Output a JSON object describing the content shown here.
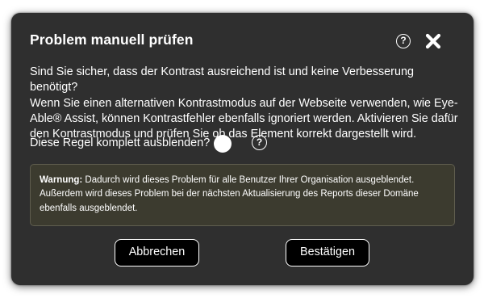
{
  "dialog": {
    "title": "Problem manuell prüfen",
    "help_icon_glyph": "?",
    "close_icon": "close-x-icon",
    "body_lines": [
      "Sind Sie sicher, dass der Kontrast ausreichend ist und keine Verbesserung benötigt?",
      "Wenn Sie einen alternativen Kontrastmodus auf der Webseite verwenden, wie Eye-",
      "Able® Assist, können Kontrastfehler ebenfalls ignoriert werden. Aktivieren Sie dafür",
      "den Kontrastmodus und prüfen Sie ob das Element korrekt dargestellt wird."
    ],
    "rule_label": "Diese Regel komplett ausblenden?",
    "rule_toggle_on": false,
    "rule_help_glyph": "?",
    "warning": {
      "label": "Warnung:",
      "line1": " Dadurch wird dieses Problem für alle Benutzer Ihrer Organisation ausgeblendet.",
      "line2": "Außerdem wird dieses Problem bei der nächsten Aktualisierung des Reports dieser Domäne",
      "line3": "ebenfalls ausgeblendet."
    },
    "cancel_label": "Abbrechen",
    "confirm_label": "Bestätigen"
  },
  "colors": {
    "dialog_bg": "#2f2f2f",
    "warning_bg": "#3c3b2f",
    "button_bg": "#000000",
    "text": "#ffffff"
  }
}
